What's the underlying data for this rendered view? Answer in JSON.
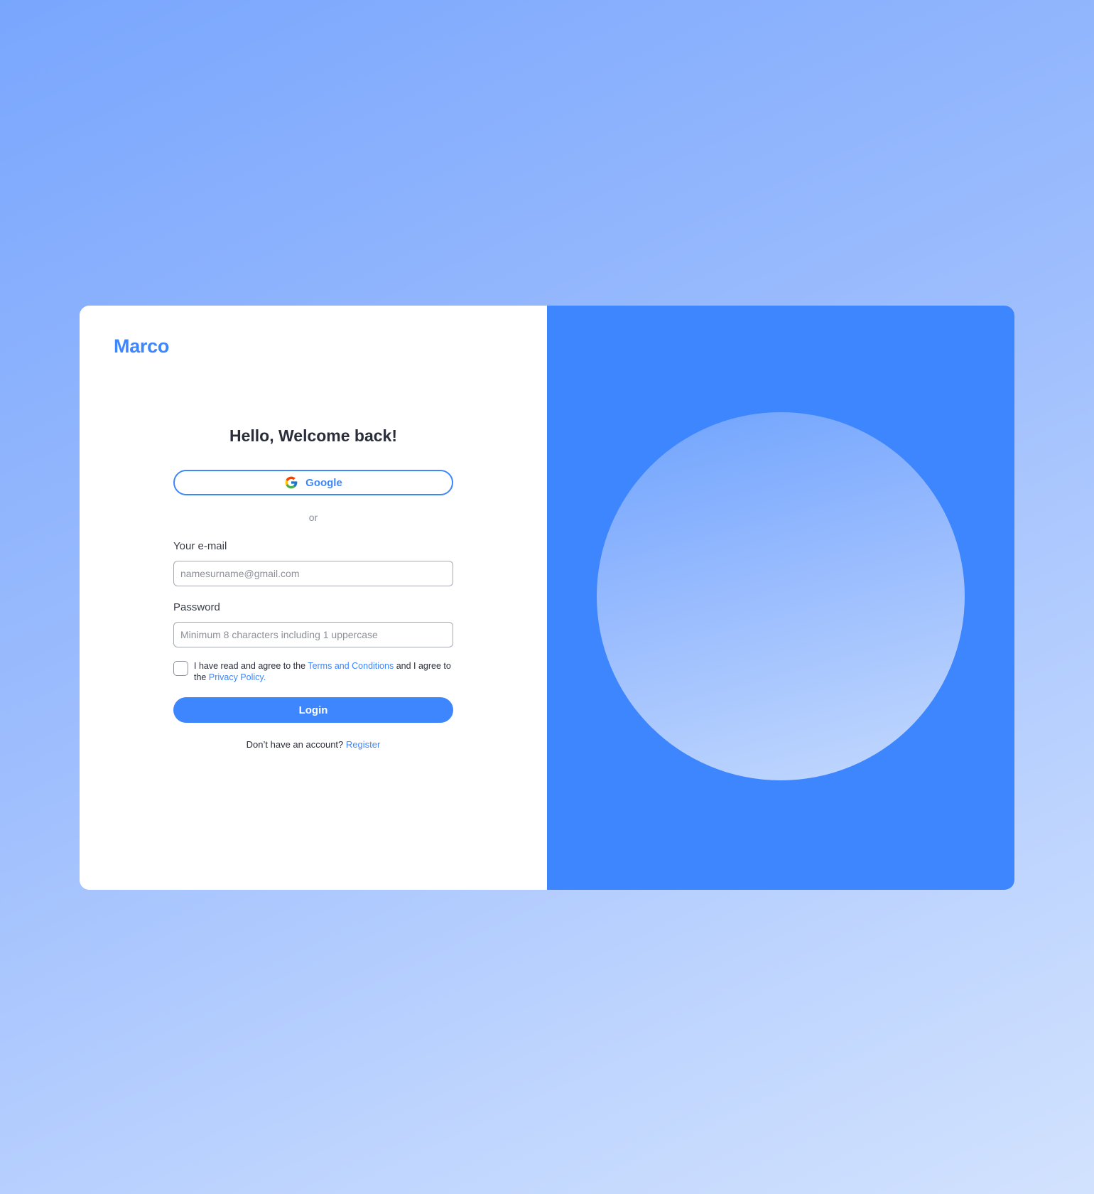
{
  "brand": {
    "name": "Marco",
    "accent_color": "#3e86fd"
  },
  "login": {
    "greeting": "Hello, Welcome back!",
    "google_button": {
      "label": "Google",
      "icon": "google-icon"
    },
    "divider_text": "or",
    "email": {
      "label": "Your e-mail",
      "placeholder": "namesurname@gmail.com",
      "value": ""
    },
    "password": {
      "label": "Password",
      "placeholder": "Minimum 8 characters including 1 uppercase",
      "value": ""
    },
    "consent": {
      "checked": false,
      "text_before": "I have read and agree to the ",
      "terms_link": "Terms and Conditions",
      "text_middle": " and I agree to the ",
      "privacy_link": "Privacy Policy."
    },
    "submit_label": "Login",
    "register": {
      "prompt": "Don’t have an account?",
      "link": "Register"
    }
  },
  "illustration": {
    "panel_color": "#3e86fd",
    "shape": "circle"
  }
}
